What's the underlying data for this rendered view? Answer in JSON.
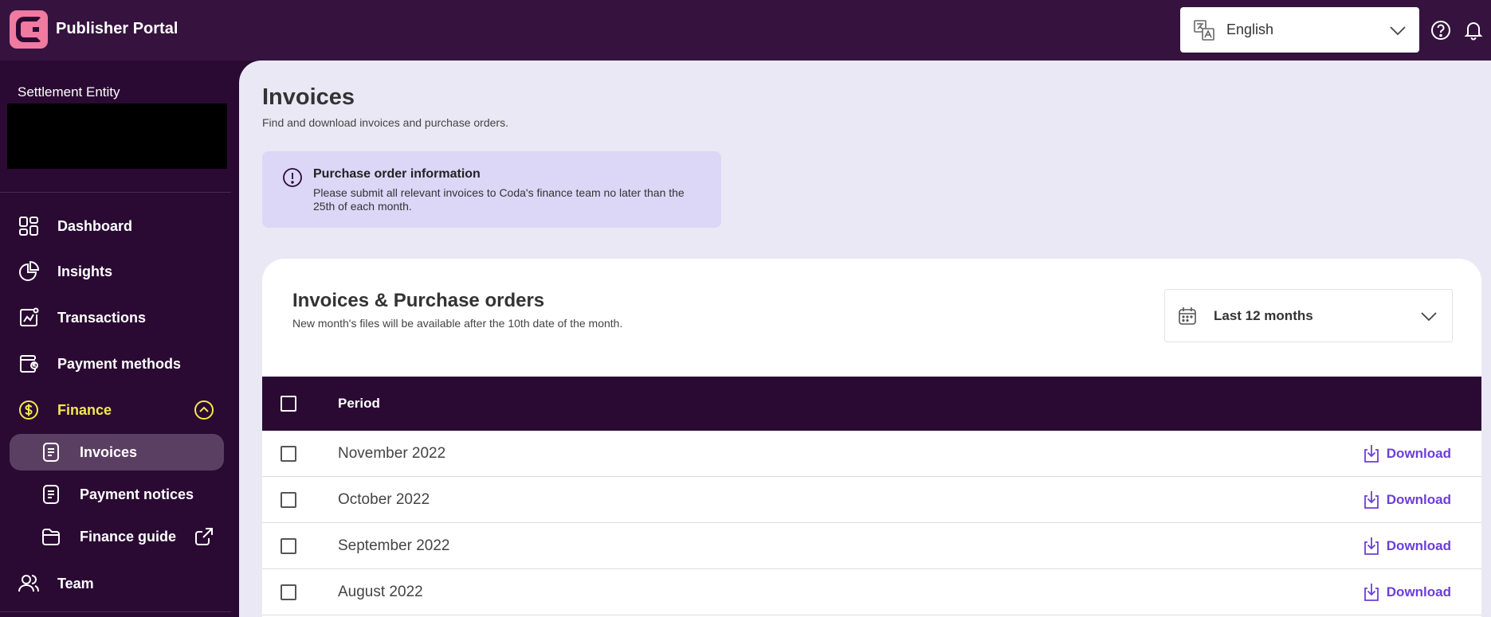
{
  "header": {
    "app_title": "Publisher Portal",
    "language": {
      "value": "English"
    }
  },
  "sidebar": {
    "entity_label": "Settlement Entity",
    "items": [
      {
        "label": "Dashboard",
        "icon": "dashboard-icon"
      },
      {
        "label": "Insights",
        "icon": "pie-chart-icon"
      },
      {
        "label": "Transactions",
        "icon": "trend-chart-icon"
      },
      {
        "label": "Payment methods",
        "icon": "wallet-icon"
      },
      {
        "label": "Finance",
        "icon": "dollar-icon",
        "expanded": true
      },
      {
        "label": "Invoices",
        "icon": "document-icon",
        "active": true
      },
      {
        "label": "Payment notices",
        "icon": "document-icon"
      },
      {
        "label": "Finance guide",
        "icon": "folder-icon"
      },
      {
        "label": "Team",
        "icon": "users-icon"
      }
    ]
  },
  "main": {
    "title": "Invoices",
    "subtitle": "Find and download invoices and purchase orders.",
    "alert": {
      "title": "Purchase order information",
      "text": "Please submit all relevant invoices to Coda's finance team no later than the 25th of each month."
    },
    "card": {
      "title": "Invoices & Purchase orders",
      "subtitle": "New month's files will be available after the 10th date of the month.",
      "range": "Last 12 months",
      "table": {
        "header_period": "Period",
        "rows": [
          {
            "period": "November 2022",
            "action": "Download"
          },
          {
            "period": "October 2022",
            "action": "Download"
          },
          {
            "period": "September 2022",
            "action": "Download"
          },
          {
            "period": "August 2022",
            "action": "Download"
          }
        ]
      }
    }
  },
  "colors": {
    "topbar": "#35133e",
    "sidebar": "#2a0a33",
    "accent_yellow": "#f3e84a",
    "link_purple": "#6b3fd8",
    "logo_pink": "#f07aa0",
    "alert_bg": "#dcd6f7"
  }
}
